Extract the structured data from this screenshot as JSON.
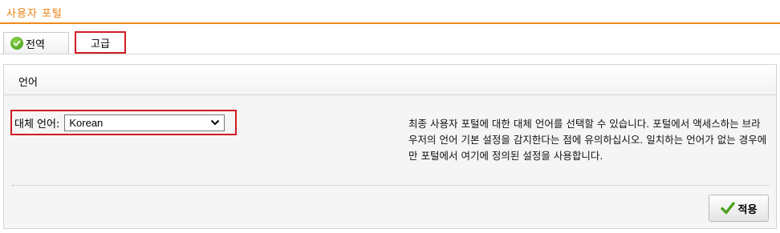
{
  "header": {
    "title": "사용자 포털"
  },
  "tabs": [
    {
      "label": "전역",
      "icon": "check-circle-icon",
      "state": "normal"
    },
    {
      "label": "고급",
      "state": "selected-highlighted"
    }
  ],
  "section": {
    "title": "언어"
  },
  "fallback_language": {
    "label": "대체 언어:",
    "selected_value": "Korean"
  },
  "help_text": "최종 사용자 포털에 대한 대체 언어를 선택할 수 있습니다. 포털에서 액세스하는 브라우저의 언어 기본 설정을 감지한다는 점에 유의하십시오. 일치하는 언어가 없는 경우에만 포털에서 여기에 정의된 설정을 사용합니다.",
  "actions": {
    "apply_label": "적용"
  },
  "colors": {
    "accent": "#f08a1c",
    "highlight": "#d01c24",
    "success": "#3d9a16"
  }
}
